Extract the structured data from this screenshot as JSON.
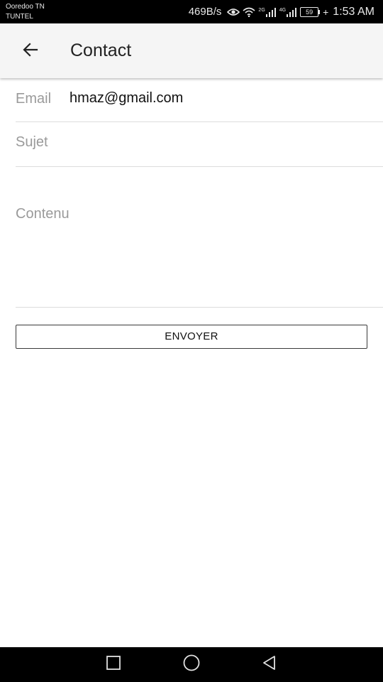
{
  "status_bar": {
    "carrier_line1": "Ooredoo TN",
    "carrier_line2": "TUNTEL",
    "net_speed": "469B/s",
    "signal_label_1": "2G",
    "signal_label_2": "4G",
    "battery_level": "59",
    "charging_symbol": "+",
    "time": "1:53 AM",
    "icons": [
      "eye-icon",
      "wifi-icon",
      "signal-2g-icon",
      "signal-4g-icon",
      "battery-icon"
    ]
  },
  "app_bar": {
    "title": "Contact",
    "back_icon": "arrow-left-icon"
  },
  "form": {
    "email_label": "Email",
    "email_value": "hmaz@gmail.com",
    "subject_placeholder": "Sujet",
    "subject_value": "",
    "content_placeholder": "Contenu",
    "content_value": "",
    "send_label": "ENVOYER"
  },
  "nav_bar": {
    "icons": [
      "recents-square-icon",
      "home-circle-icon",
      "back-triangle-icon"
    ]
  },
  "colors": {
    "status_bar_bg": "#000000",
    "app_bar_bg": "#f5f5f5",
    "label_gray": "#9a9a9a",
    "divider": "#dcdcdc",
    "button_border": "#3a3a3a"
  }
}
